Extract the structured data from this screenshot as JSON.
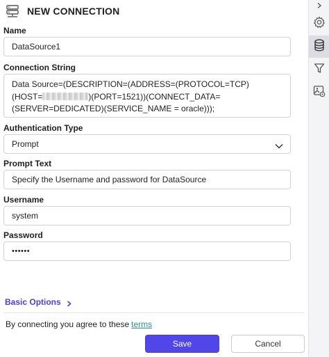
{
  "header": {
    "title": "NEW CONNECTION",
    "icon": "server-icon"
  },
  "form": {
    "name": {
      "label": "Name",
      "value": "DataSource1"
    },
    "connection_string": {
      "label": "Connection String",
      "line1": "Data Source=(DESCRIPTION=(ADDRESS=(PROTOCOL=TCP)",
      "line2_prefix": "(HOST=",
      "line2_suffix": ")(PORT=1521))(CONNECT_DATA=",
      "line3": "(SERVER=DEDICATED)(SERVICE_NAME = oracle)));"
    },
    "auth_type": {
      "label": "Authentication Type",
      "value": "Prompt"
    },
    "prompt_text": {
      "label": "Prompt Text",
      "value": "Specify the Username and password for DataSource"
    },
    "username": {
      "label": "Username",
      "value": "system"
    },
    "password": {
      "label": "Password",
      "value": "••••••"
    }
  },
  "basic_options": {
    "label": "Basic Options"
  },
  "terms": {
    "text": "By connecting you agree to these",
    "link": "terms"
  },
  "buttons": {
    "save": "Save",
    "cancel": "Cancel"
  },
  "rightbar": {
    "collapse_icon": "chevron-right-icon",
    "items": [
      "gear-icon",
      "database-icon",
      "filter-icon",
      "image-settings-icon"
    ],
    "active_item": "database-icon"
  },
  "colors": {
    "accent": "#5146e8",
    "link": "#2a8c96",
    "basic_options": "#4a3fd6"
  }
}
